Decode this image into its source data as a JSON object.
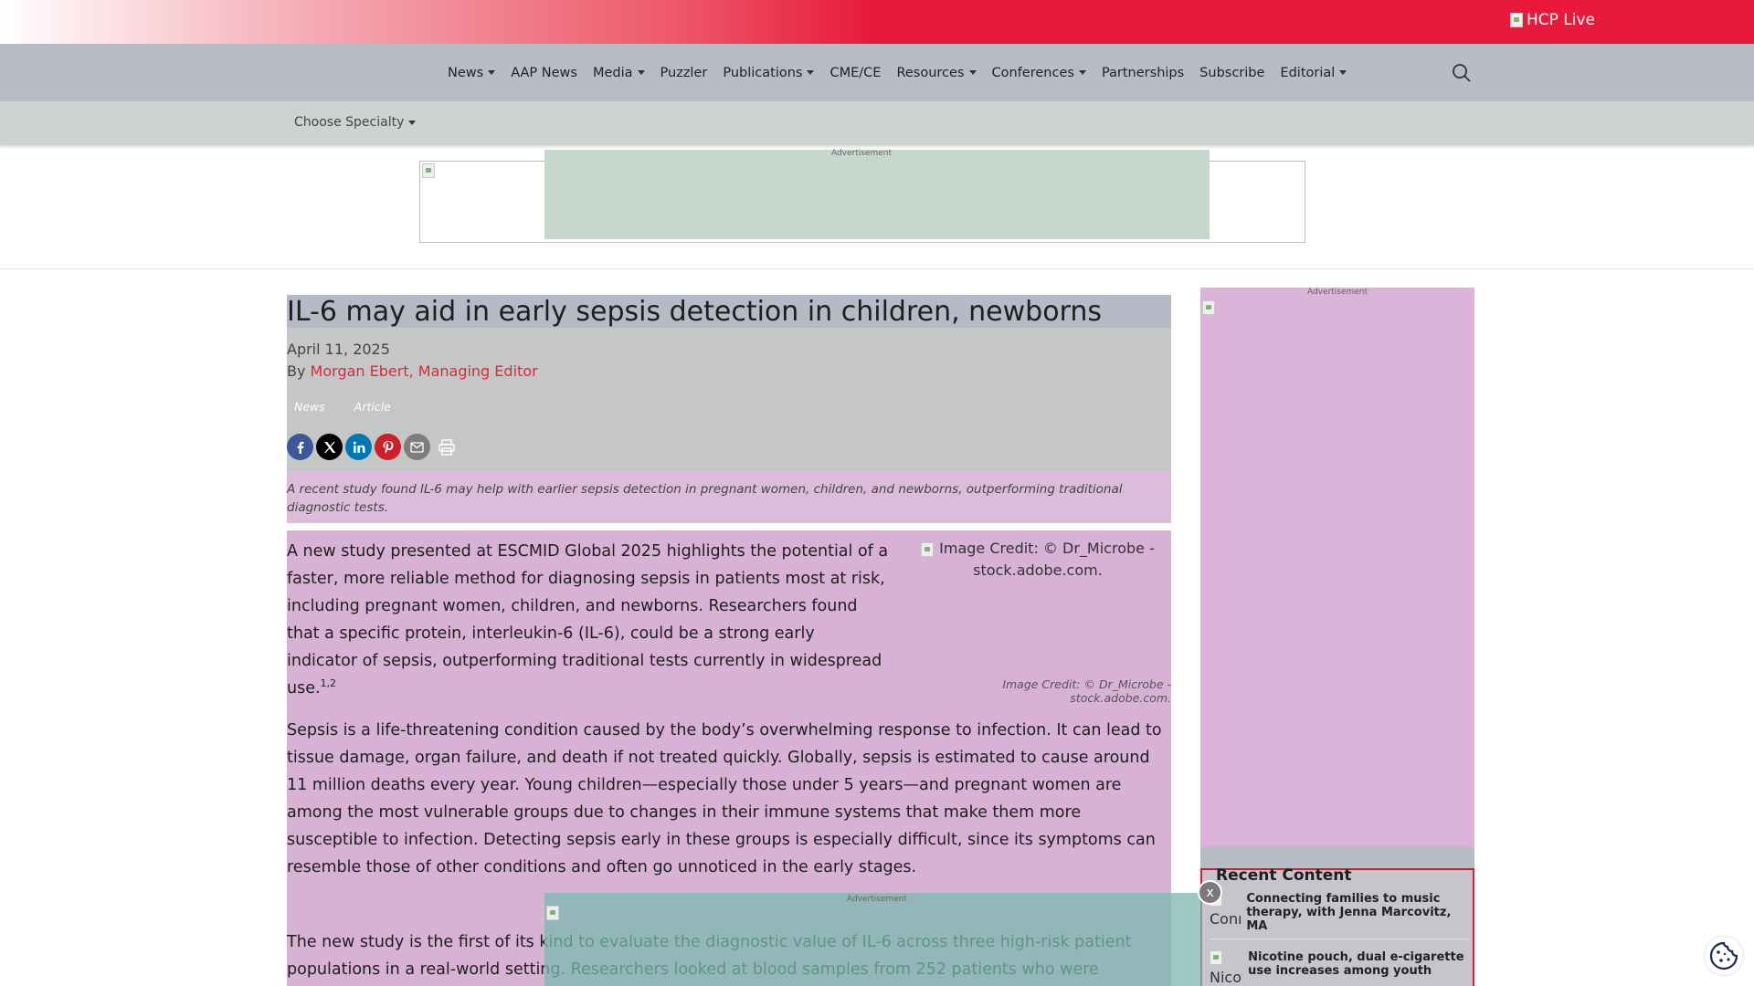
{
  "brand": {
    "logo_alt": "HCP Live"
  },
  "nav": {
    "items": [
      {
        "label": "News",
        "dropdown": true
      },
      {
        "label": "AAP News",
        "dropdown": false
      },
      {
        "label": "Media",
        "dropdown": true
      },
      {
        "label": "Puzzler",
        "dropdown": false
      },
      {
        "label": "Publications",
        "dropdown": true
      },
      {
        "label": "CME/CE",
        "dropdown": false
      },
      {
        "label": "Resources",
        "dropdown": true
      },
      {
        "label": "Conferences",
        "dropdown": true
      },
      {
        "label": "Partnerships",
        "dropdown": false
      },
      {
        "label": "Subscribe",
        "dropdown": false
      },
      {
        "label": "Editorial",
        "dropdown": true
      }
    ]
  },
  "specialty": {
    "label": "Choose Specialty"
  },
  "ads": {
    "label": "Advertisement"
  },
  "article": {
    "title": "IL-6 may aid in early sepsis detection in children, newborns",
    "date": "April 11, 2025",
    "by": "By",
    "author": "Morgan Ebert, Managing Editor",
    "tags": [
      "News",
      "Article"
    ],
    "summary": "A recent study found IL-6 may help with earlier sepsis detection in pregnant women, children, and newborns, outperforming traditional diagnostic tests.",
    "image_alt": "Image Credit: © Dr_Microbe - stock.adobe.com.",
    "image_caption": "Image Credit: © Dr_Microbe - stock.adobe.com.",
    "p1": "A new study presented at ESCMID Global 2025 highlights the potential of a faster, more reliable method for diagnosing sepsis in patients most at risk, including pregnant women, children, and newborns. Researchers found that a specific protein, interleukin-6 (IL-6), could be a strong early indicator of sepsis, outperforming traditional tests currently in widespread use.",
    "p1_refs": "1,2",
    "p2": "Sepsis is a life-threatening condition caused by the body’s overwhelming response to infection. It can lead to tissue damage, organ failure, and death if not treated quickly. Globally, sepsis is estimated to cause around 11 million deaths every year. Young children—especially those under 5 years—and pregnant women are among the most vulnerable groups due to changes in their immune systems that make them more susceptible to infection. Detecting sepsis early in these groups is especially difficult, since its symptoms can resemble those of other conditions and often go unnoticed in the early stages.",
    "p3": "The new study is the first of its kind to evaluate the diagnostic value of IL-6 across three high-risk patient populations in a real-world setting. Researchers looked at blood samples from 252 patients who were"
  },
  "sidebar": {
    "recent_title": "Recent Content",
    "items": [
      {
        "thumb_alt": "Connecting",
        "title": "Connecting families to music therapy, with Jenna Marcovitz, MA"
      },
      {
        "thumb_alt": "Nicotine",
        "title": "Nicotine pouch, dual e-cigarette use increases among youth"
      }
    ]
  },
  "close_label": "x",
  "colors": {
    "brand_red": "#e8193a",
    "link_red": "#e0263c",
    "facebook": "#3b5998",
    "twitter": "#000000",
    "linkedin": "#0077b5",
    "pinterest": "#cb2027",
    "email": "#7d7d7d"
  }
}
